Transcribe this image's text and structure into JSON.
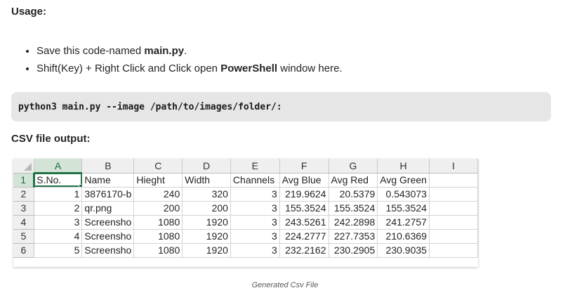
{
  "usage": {
    "heading": "Usage:",
    "steps": [
      {
        "prefix": "Save this code-named ",
        "bold": "main.py",
        "suffix": "."
      },
      {
        "prefix": "Shift(Key) + Right Click and Click open ",
        "bold": "PowerShell",
        "suffix": " window here."
      }
    ]
  },
  "code": {
    "command": "python3 main.py --image /path/to/images/folder/:"
  },
  "csv": {
    "heading": "CSV file output:",
    "column_letters": [
      "A",
      "B",
      "C",
      "D",
      "E",
      "F",
      "G",
      "H",
      "I"
    ],
    "row_numbers": [
      "1",
      "2",
      "3",
      "4",
      "5",
      "6"
    ],
    "header_row": [
      "S.No.",
      "Name",
      "Hieght",
      "Width",
      "Channels",
      "Avg Blue",
      "Avg Red",
      "Avg Green",
      ""
    ],
    "rows": [
      [
        "1",
        "3876170-b",
        "240",
        "320",
        "3",
        "219.9624",
        "20.5379",
        "0.543073",
        ""
      ],
      [
        "2",
        "qr.png",
        "200",
        "200",
        "3",
        "155.3524",
        "155.3524",
        "155.3524",
        ""
      ],
      [
        "3",
        "Screensho",
        "1080",
        "1920",
        "3",
        "243.5261",
        "242.2898",
        "241.2757",
        ""
      ],
      [
        "4",
        "Screensho",
        "1080",
        "1920",
        "3",
        "224.2777",
        "227.7353",
        "210.6369",
        ""
      ],
      [
        "5",
        "Screensho",
        "1080",
        "1920",
        "3",
        "232.2162",
        "230.2905",
        "230.9035",
        ""
      ]
    ],
    "caption": "Generated Csv File"
  },
  "colors": {
    "code_background": "#e6e6e6",
    "excel_accent": "#217346",
    "header_background": "#efefef"
  }
}
